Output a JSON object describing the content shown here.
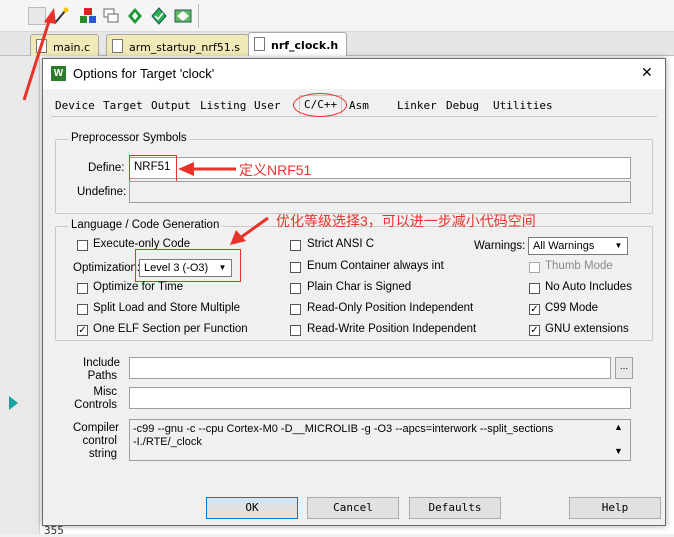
{
  "tabs": [
    {
      "label": "main.c",
      "active": false
    },
    {
      "label": "arm_startup_nrf51.s",
      "active": false
    },
    {
      "label": "nrf_clock.h",
      "active": true
    }
  ],
  "editor": {
    "line_number": "355"
  },
  "dialog": {
    "title": "Options for Target 'clock'",
    "close_glyph": "✕",
    "tabs": [
      "Device",
      "Target",
      "Output",
      "Listing",
      "User",
      "C/C++",
      "Asm",
      "Linker",
      "Debug",
      "Utilities"
    ],
    "active_tab": "C/C++",
    "preprocessor": {
      "group_label": "Preprocessor Symbols",
      "define_label": "Define:",
      "define_value": "NRF51",
      "undefine_label": "Undefine:",
      "undefine_value": ""
    },
    "language": {
      "group_label": "Language / Code Generation",
      "execute_only_code": {
        "label": "Execute-only Code",
        "checked": false
      },
      "optimization_label": "Optimization:",
      "optimization_value": "Level 3 (-O3)",
      "optimize_for_time": {
        "label": "Optimize for Time",
        "checked": false
      },
      "split_load_store": {
        "label": "Split Load and Store Multiple",
        "checked": false
      },
      "one_elf_section": {
        "label": "One ELF Section per Function",
        "checked": true
      },
      "strict_ansi_c": {
        "label": "Strict ANSI C",
        "checked": false
      },
      "enum_container": {
        "label": "Enum Container always int",
        "checked": false
      },
      "plain_char_signed": {
        "label": "Plain Char is Signed",
        "checked": false
      },
      "readonly_pi": {
        "label": "Read-Only Position Independent",
        "checked": false
      },
      "readwrite_pi": {
        "label": "Read-Write Position Independent",
        "checked": false
      },
      "warnings_label": "Warnings:",
      "warnings_value": "All Warnings",
      "thumb_mode": {
        "label": "Thumb Mode",
        "checked": false
      },
      "no_auto_includes": {
        "label": "No Auto Includes",
        "checked": false
      },
      "c99_mode": {
        "label": "C99 Mode",
        "checked": true
      },
      "gnu_extensions": {
        "label": "GNU extensions",
        "checked": true
      }
    },
    "include_paths": {
      "label_line1": "Include",
      "label_line2": "Paths",
      "value": "",
      "browse": "..."
    },
    "misc_controls": {
      "label_line1": "Misc",
      "label_line2": "Controls",
      "value": ""
    },
    "compiler_control": {
      "label_line1": "Compiler",
      "label_line2": "control",
      "label_line3": "string",
      "line1": "-c99 --gnu -c --cpu Cortex-M0 -D__MICROLIB -g -O3 --apcs=interwork --split_sections",
      "line2": "-I./RTE/_clock"
    },
    "buttons": {
      "ok": "OK",
      "cancel": "Cancel",
      "defaults": "Defaults",
      "help": "Help"
    }
  },
  "annotations": {
    "define_note": "定义NRF51",
    "optimization_note": "优化等级选择3，可以进一步减小代码空间"
  },
  "colors": {
    "annotation_red": "#e8332b",
    "tab_yellow": "#f2e9b8"
  }
}
